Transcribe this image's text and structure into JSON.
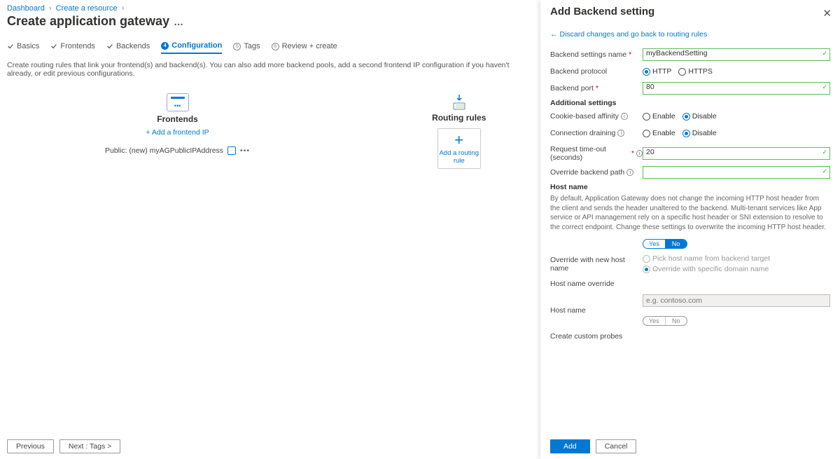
{
  "breadcrumbs": [
    "Dashboard",
    "Create a resource"
  ],
  "page_title": "Create application gateway",
  "tabs": {
    "basics": "Basics",
    "frontends": "Frontends",
    "backends": "Backends",
    "configuration": "Configuration",
    "tags": "Tags",
    "review": "Review + create"
  },
  "config_desc": "Create routing rules that link your frontend(s) and backend(s). You can also add more backend pools, add a second frontend IP configuration if you haven't already, or edit previous configurations.",
  "frontends": {
    "heading": "Frontends",
    "add_link": "+ Add a frontend IP",
    "row_label": "Public: (new) myAGPublicIPAddress"
  },
  "routing": {
    "heading": "Routing rules",
    "card_label": "Add a routing rule"
  },
  "footer": {
    "prev": "Previous",
    "next": "Next : Tags >"
  },
  "panel": {
    "title": "Add Backend setting",
    "discard": "Discard changes and go back to routing rules",
    "fields": {
      "name_label": "Backend settings name",
      "name_value": "myBackendSetting",
      "protocol_label": "Backend protocol",
      "protocol_http": "HTTP",
      "protocol_https": "HTTPS",
      "port_label": "Backend port",
      "port_value": "80",
      "additional": "Additional settings",
      "affinity_label": "Cookie-based affinity",
      "drain_label": "Connection draining",
      "enable": "Enable",
      "disable": "Disable",
      "timeout_label": "Request time-out (seconds)",
      "timeout_value": "20",
      "override_path_label": "Override backend path",
      "hostname_heading": "Host name",
      "hostname_hint": "By default, Application Gateway does not change the incoming HTTP host header from the client and sends the header unaltered to the backend. Multi-tenant services like App service or API management rely on a specific host header or SNI extension to resolve to the correct endpoint. Change these settings to overwrite the incoming HTTP host header.",
      "yes": "Yes",
      "no": "No",
      "override_new_label": "Override with new host name",
      "pick_backend": "Pick host name from backend target",
      "override_domain": "Override with specific domain name",
      "hostname_override_label": "Host name override",
      "hostname_label": "Host name",
      "hostname_placeholder": "e.g. contoso.com",
      "probes_label": "Create custom probes"
    },
    "footer": {
      "add": "Add",
      "cancel": "Cancel"
    }
  }
}
